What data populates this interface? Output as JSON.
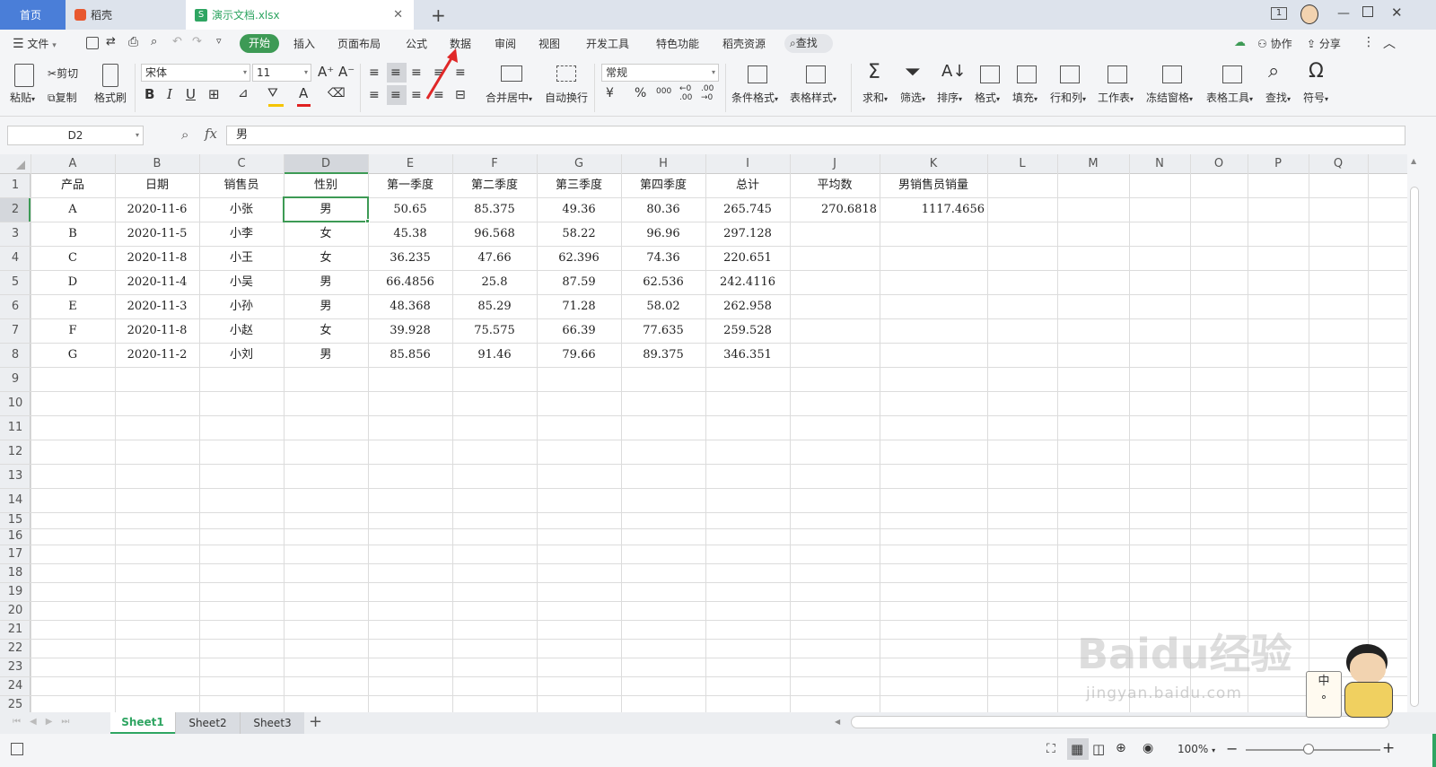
{
  "tabs": {
    "home": "首页",
    "daoke": "稻壳",
    "file": "演示文档.xlsx",
    "new_tab": "+",
    "page_count": "1"
  },
  "menu": {
    "file": "文件",
    "items": [
      "开始",
      "插入",
      "页面布局",
      "公式",
      "数据",
      "审阅",
      "视图",
      "开发工具",
      "特色功能",
      "稻壳资源",
      "查找"
    ],
    "collab": "协作",
    "share": "分享"
  },
  "ribbon": {
    "paste": "粘贴",
    "cut": "剪切",
    "copy": "复制",
    "format_painter": "格式刷",
    "font": "宋体",
    "size": "11",
    "merge": "合并居中",
    "wrap": "自动换行",
    "numfmt": "常规",
    "cond": "条件格式",
    "table_style": "表格样式",
    "sum": "求和",
    "filter": "筛选",
    "sort": "排序",
    "format": "格式",
    "fill": "填充",
    "rowcol": "行和列",
    "sheet": "工作表",
    "freeze": "冻结窗格",
    "table_tools": "表格工具",
    "find": "查找",
    "symbol": "符号",
    "pct": "%",
    "thousand": "000"
  },
  "formula": {
    "namebox": "D2",
    "fx": "fx",
    "value": "男"
  },
  "columns": [
    "A",
    "B",
    "C",
    "D",
    "E",
    "F",
    "G",
    "H",
    "I",
    "J",
    "K",
    "L",
    "M",
    "N",
    "O",
    "P",
    "Q"
  ],
  "rows": [
    "1",
    "2",
    "3",
    "4",
    "5",
    "6",
    "7",
    "8",
    "9",
    "10",
    "11",
    "12",
    "13",
    "14",
    "15",
    "16",
    "17",
    "18",
    "19",
    "20",
    "21",
    "22",
    "23",
    "24",
    "25"
  ],
  "headers": [
    "产品",
    "日期",
    "销售员",
    "性别",
    "第一季度",
    "第二季度",
    "第三季度",
    "第四季度",
    "总计",
    "平均数",
    "男销售员销量"
  ],
  "data": [
    [
      "A",
      "2020-11-6",
      "小张",
      "男",
      "50.65",
      "85.375",
      "49.36",
      "80.36",
      "265.745",
      "270.6818",
      "1117.4656"
    ],
    [
      "B",
      "2020-11-5",
      "小李",
      "女",
      "45.38",
      "96.568",
      "58.22",
      "96.96",
      "297.128",
      "",
      ""
    ],
    [
      "C",
      "2020-11-8",
      "小王",
      "女",
      "36.235",
      "47.66",
      "62.396",
      "74.36",
      "220.651",
      "",
      ""
    ],
    [
      "D",
      "2020-11-4",
      "小吴",
      "男",
      "66.4856",
      "25.8",
      "87.59",
      "62.536",
      "242.4116",
      "",
      ""
    ],
    [
      "E",
      "2020-11-3",
      "小孙",
      "男",
      "48.368",
      "85.29",
      "71.28",
      "58.02",
      "262.958",
      "",
      ""
    ],
    [
      "F",
      "2020-11-8",
      "小赵",
      "女",
      "39.928",
      "75.575",
      "66.39",
      "77.635",
      "259.528",
      "",
      ""
    ],
    [
      "G",
      "2020-11-2",
      "小刘",
      "男",
      "85.856",
      "91.46",
      "79.66",
      "89.375",
      "346.351",
      "",
      ""
    ]
  ],
  "sheets": [
    "Sheet1",
    "Sheet2",
    "Sheet3"
  ],
  "status": {
    "zoom": "100%",
    "ime": "中",
    "watermark": "Baidu经验",
    "watermark_url": "jingyan.baidu.com"
  }
}
